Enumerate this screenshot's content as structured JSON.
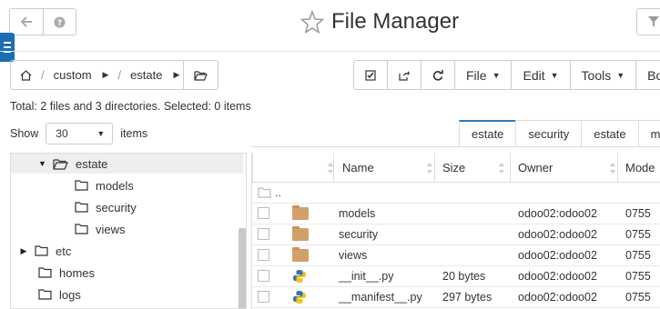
{
  "window": {
    "title": "File Manager",
    "back_icon": "arrow-left-icon",
    "help_icon": "question-circle-icon",
    "favorite_icon": "star-outline-icon",
    "filter_icon": "funnel-icon",
    "menu_icon": "hamburger-icon"
  },
  "breadcrumb": {
    "home_icon": "home-icon",
    "parts": [
      "custom",
      "estate"
    ],
    "open_folder_icon": "folder-open-icon"
  },
  "toolbar": {
    "select_all_icon": "check-square-icon",
    "share_icon": "share-icon",
    "refresh_icon": "refresh-icon",
    "file_label": "File",
    "edit_label": "Edit",
    "tools_label": "Tools",
    "more_label": "Bo"
  },
  "summary": "Total: 2 files and 3 directories. Selected: 0 items",
  "paging": {
    "show_label": "Show",
    "per_page": "30",
    "items_label": "items"
  },
  "tabs": [
    "estate",
    "security",
    "estate",
    "m"
  ],
  "tree": [
    {
      "label": "estate",
      "expanded": true,
      "selected": true
    },
    {
      "label": "models"
    },
    {
      "label": "security"
    },
    {
      "label": "views"
    },
    {
      "label": "etc",
      "collapsed": true
    },
    {
      "label": "homes"
    },
    {
      "label": "logs"
    }
  ],
  "grid": {
    "columns": [
      "Name",
      "Size",
      "Owner",
      "Mode"
    ],
    "parent_label": "..",
    "rows": [
      {
        "type": "folder",
        "name": "models",
        "size": "",
        "owner": "odoo02:odoo02",
        "mode": "0755"
      },
      {
        "type": "folder",
        "name": "security",
        "size": "",
        "owner": "odoo02:odoo02",
        "mode": "0755"
      },
      {
        "type": "folder",
        "name": "views",
        "size": "",
        "owner": "odoo02:odoo02",
        "mode": "0755"
      },
      {
        "type": "python",
        "name": "__init__.py",
        "size": "20 bytes",
        "owner": "odoo02:odoo02",
        "mode": "0755"
      },
      {
        "type": "python",
        "name": "__manifest__.py",
        "size": "297 bytes",
        "owner": "odoo02:odoo02",
        "mode": "0755"
      }
    ]
  },
  "colors": {
    "accent": "#337ab7",
    "menu_tab": "#1a6fb3",
    "folder": "#d1a06b"
  }
}
